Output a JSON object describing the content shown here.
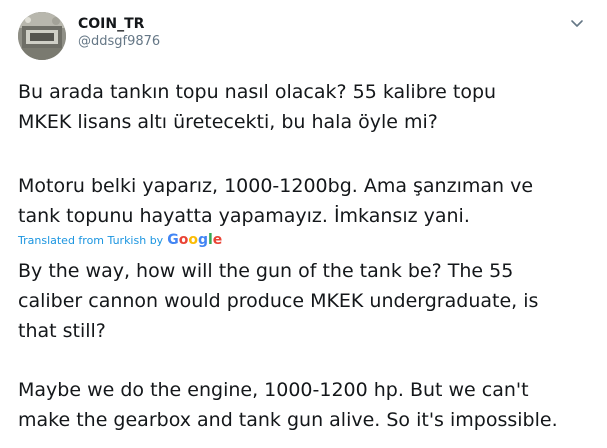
{
  "author": {
    "display_name": "COIN_TR",
    "handle": "@ddsgf9876"
  },
  "icons": {
    "avatar": "avatar-image",
    "more": "chevron-down-icon"
  },
  "original_text": {
    "paragraph_1": "Bu arada tankın topu nasıl olacak? 55 kalibre topu\nMKEK lisans altı üretecekti, bu hala öyle mi?",
    "paragraph_2": "Motoru belki yaparız, 1000-1200bg. Ama şanzıman ve\ntank topunu hayatta yapamayız. İmkansız yani."
  },
  "translation": {
    "label": "Translated from Turkish by",
    "provider_letters": [
      "G",
      "o",
      "o",
      "g",
      "l",
      "e"
    ],
    "paragraph_1": "By the way, how will the gun of the tank be? The 55\ncaliber cannon would produce MKEK undergraduate, is\nthat still?",
    "paragraph_2": " Maybe we do the engine, 1000-1200 hp. But we can't\nmake the gearbox and tank gun alive. So it's impossible."
  },
  "colors": {
    "link": "#1b95e0",
    "secondary_text": "#657786",
    "primary_text": "#14171a"
  }
}
